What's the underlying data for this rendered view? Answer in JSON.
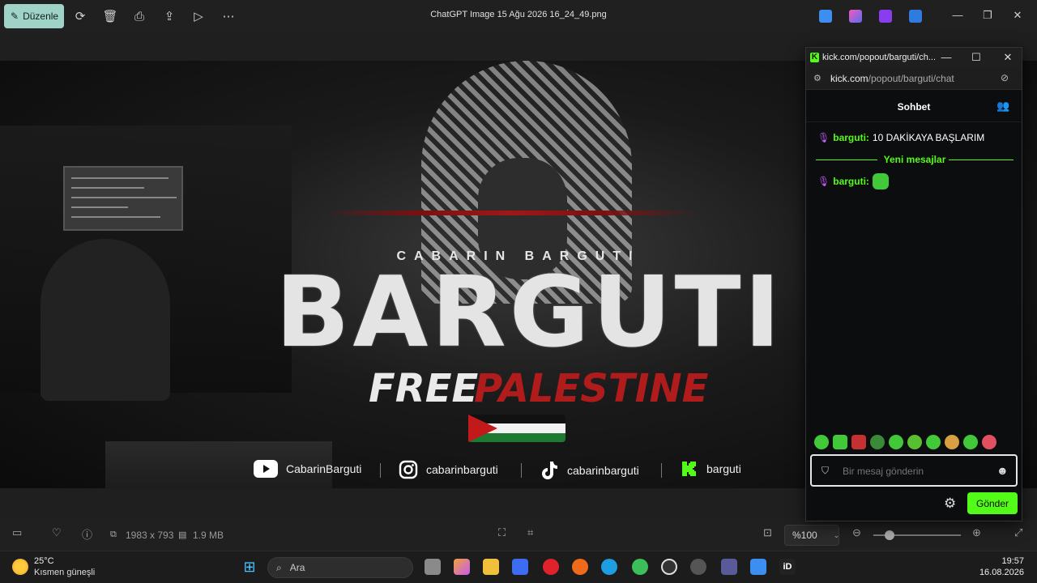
{
  "toolbar": {
    "edit_label": "Düzenle",
    "file_title": "ChatGPT Image 15 Ağu 2026 16_24_49.png"
  },
  "banner": {
    "subtitle": "CABARIN BARGUTI",
    "title": "BARGUTI",
    "free": "FREE",
    "palestine": "PALESTINE",
    "socials": [
      {
        "platform": "youtube",
        "handle": "CabarinBarguti"
      },
      {
        "platform": "instagram",
        "handle": "cabarinbarguti"
      },
      {
        "platform": "tiktok",
        "handle": "cabarinbarguti"
      },
      {
        "platform": "kick",
        "handle": "barguti"
      }
    ]
  },
  "status": {
    "dimensions": "1983 x 793",
    "size": "1.9 MB",
    "zoom": "%100"
  },
  "chat": {
    "window_title": "kick.com/popout/barguti/ch...",
    "url_host": "kick.com",
    "url_path": "/popout/barguti/chat",
    "header": "Sohbet",
    "messages": [
      {
        "user": "barguti",
        "text": "10 DAKİKAYA BAŞLARIM"
      },
      {
        "user": "barguti",
        "text": ""
      }
    ],
    "new_messages_label": "Yeni mesajlar",
    "input_placeholder": "Bir mesaj gönderin",
    "send_label": "Gönder"
  },
  "taskbar": {
    "temperature": "25°C",
    "weather": "Kısmen güneşli",
    "search_label": "Ara",
    "time": "19:57",
    "date": "16.08.2026"
  },
  "colors": {
    "kick_green": "#53fc18",
    "accent_edit": "#9fd3c7",
    "palestine_red": "#b01c1c"
  }
}
